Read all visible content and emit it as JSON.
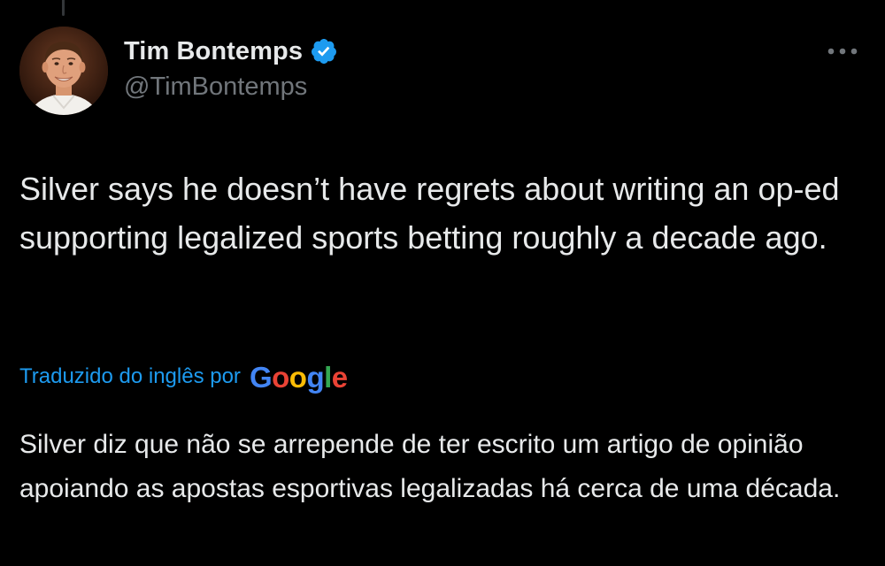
{
  "tweet": {
    "author": {
      "display_name": "Tim Bontemps",
      "handle": "@TimBontemps",
      "verified": true,
      "avatar_icon": "profile-photo"
    },
    "text": "Silver says he doesn’t have regrets about writing an op-ed supporting legalized sports betting roughly a decade ago.",
    "translation": {
      "label": "Traduzido do inglês por",
      "provider": "Google",
      "provider_letters": [
        "G",
        "o",
        "o",
        "g",
        "l",
        "e"
      ],
      "provider_colors": [
        "#4285F4",
        "#EA4335",
        "#FBBC05",
        "#4285F4",
        "#34A853",
        "#EA4335"
      ],
      "text": "Silver diz que não se arrepende de ter escrito um artigo de opinião apoiando as apostas esportivas legalizadas há cerca de uma década."
    },
    "more_icon": "ellipsis-icon"
  },
  "theme": {
    "background": "#000000",
    "text_primary": "#e7e9ea",
    "text_secondary": "#71767b",
    "accent": "#1d9bf0",
    "verified_badge": "#1d9bf0"
  }
}
